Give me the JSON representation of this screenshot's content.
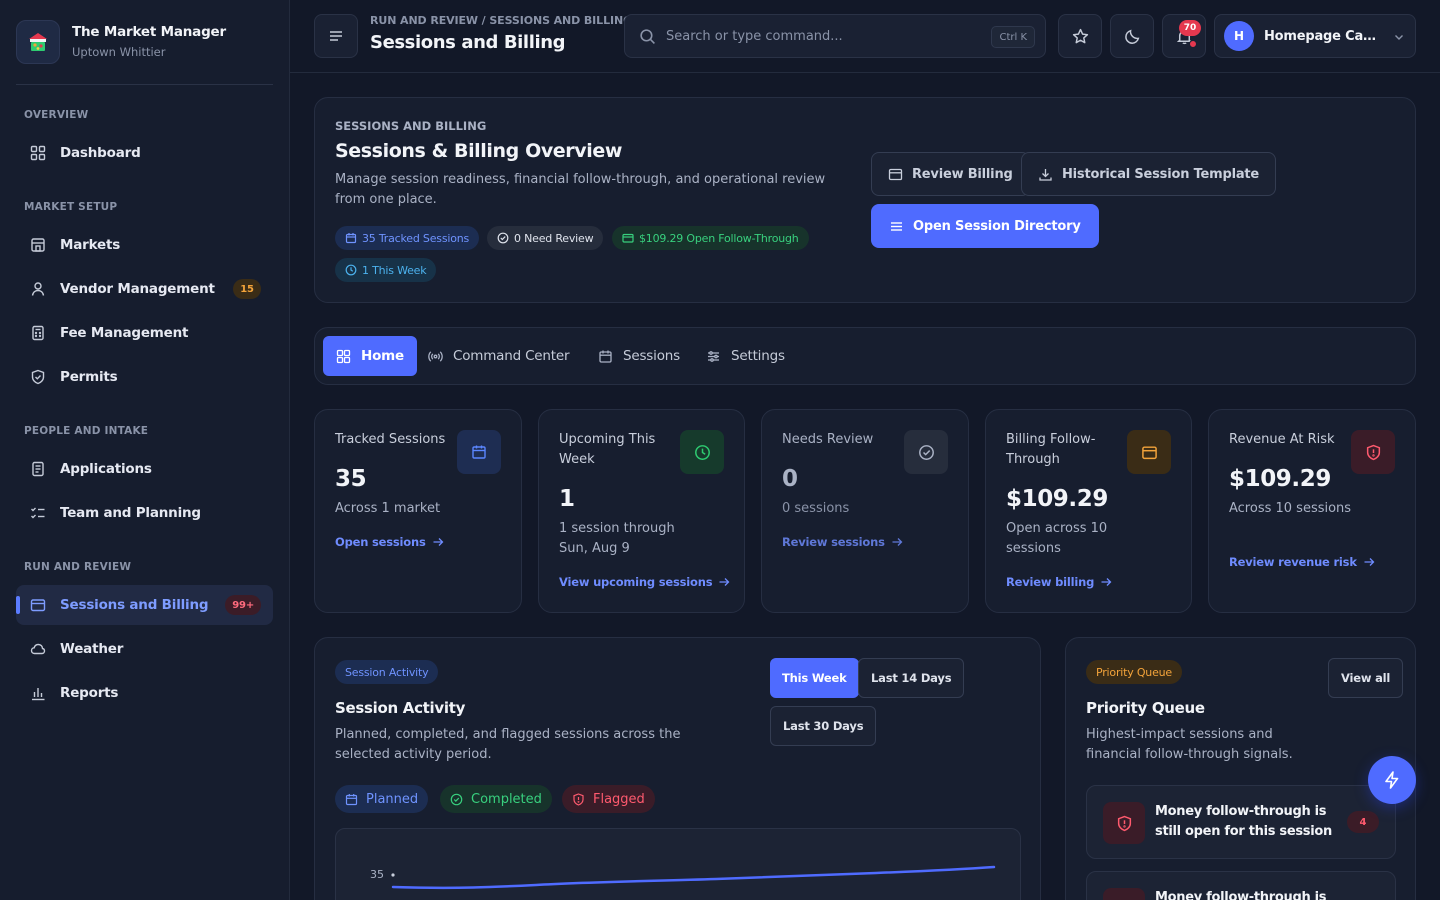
{
  "brand": {
    "name": "The Market Manager",
    "subtitle": "Uptown Whittier"
  },
  "sidebar": {
    "sections": [
      "Overview",
      "Market Setup",
      "People and Intake",
      "Run and Review"
    ],
    "items": [
      {
        "label": "Dashboard",
        "icon": "grid-icon"
      },
      {
        "label": "Markets",
        "icon": "store-icon"
      },
      {
        "label": "Vendor Management",
        "icon": "user-icon",
        "badge": "15"
      },
      {
        "label": "Fee Management",
        "icon": "calculator-icon"
      },
      {
        "label": "Permits",
        "icon": "shield-icon"
      },
      {
        "label": "Applications",
        "icon": "document-icon"
      },
      {
        "label": "Team and Planning",
        "icon": "checklist-icon"
      },
      {
        "label": "Sessions and Billing",
        "icon": "wallet-icon",
        "badge": "99+",
        "active": true
      },
      {
        "label": "Weather",
        "icon": "cloud-icon"
      },
      {
        "label": "Reports",
        "icon": "bar-chart-icon"
      }
    ]
  },
  "topbar": {
    "breadcrumb": "RUN AND REVIEW / SESSIONS AND BILLING",
    "title": "Sessions and Billing",
    "search_placeholder": "Search or type command...",
    "shortcut": "Ctrl K",
    "notification_count": "70",
    "user_initial": "H",
    "user_name": "Homepage Capt..."
  },
  "overview": {
    "kicker": "SESSIONS AND BILLING",
    "title": "Sessions & Billing Overview",
    "description": "Manage session readiness, financial follow-through, and operational review from one place.",
    "pills": [
      "35 Tracked Sessions",
      "0 Need Review",
      "$109.29 Open Follow-Through",
      "1 This Week"
    ],
    "buttons": {
      "review_billing": "Review Billing",
      "template": "Historical Session Template",
      "directory": "Open Session Directory"
    }
  },
  "tabs": [
    "Home",
    "Command Center",
    "Sessions",
    "Settings"
  ],
  "stats": [
    {
      "title": "Tracked Sessions",
      "value": "35",
      "sub": "Across 1 market",
      "link": "Open sessions",
      "color": "#4f7bff"
    },
    {
      "title": "Upcoming This Week",
      "value": "1",
      "sub": "1 session through Sun, Aug 9",
      "link": "View upcoming sessions",
      "color": "#2ecc71"
    },
    {
      "title": "Needs Review",
      "value": "0",
      "sub": "0 sessions",
      "link": "Review sessions",
      "color": "#aab2c5"
    },
    {
      "title": "Billing Follow-Through",
      "value": "$109.29",
      "sub": "Open across 10 sessions",
      "link": "Review billing",
      "color": "#f3a33a"
    },
    {
      "title": "Revenue At Risk",
      "value": "$109.29",
      "sub": "Across 10 sessions",
      "link": "Review revenue risk",
      "color": "#ff5a6e"
    }
  ],
  "activity": {
    "kicker": "Session Activity",
    "title": "Session Activity",
    "description": "Planned, completed, and flagged sessions across the selected activity period.",
    "ranges": [
      "This Week",
      "Last 14 Days",
      "Last 30 Days"
    ],
    "legend": [
      "Planned",
      "Completed",
      "Flagged"
    ],
    "y_tick": "35"
  },
  "chart_data": {
    "type": "line",
    "series": [
      {
        "name": "Planned",
        "values": [
          35,
          35,
          35,
          35,
          35,
          35,
          35
        ]
      }
    ],
    "y_tick_labels": [
      "35"
    ]
  },
  "priority": {
    "kicker": "Priority Queue",
    "title": "Priority Queue",
    "view_all": "View all",
    "description": "Highest-impact sessions and financial follow-through signals.",
    "items": [
      {
        "text": "Money follow-through is still open for this session",
        "count": "4"
      },
      {
        "text": "Money follow-through is still open for this session",
        "count": ""
      }
    ]
  }
}
